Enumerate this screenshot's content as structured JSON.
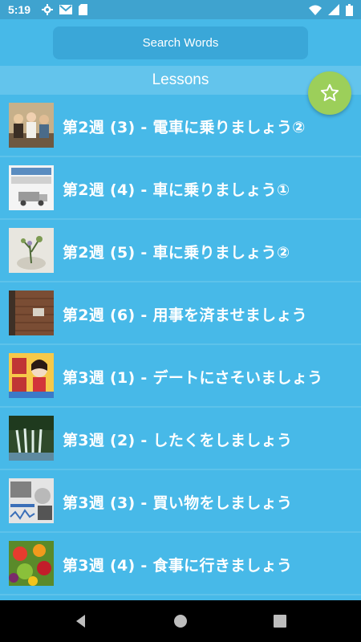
{
  "status_bar": {
    "time": "5:19",
    "left_icons": [
      "gear-icon",
      "gmail-icon",
      "sd-card-icon"
    ],
    "right_icons": [
      "wifi-icon",
      "signal-icon",
      "battery-icon"
    ]
  },
  "search": {
    "label": "Search Words"
  },
  "header": {
    "title": "Lessons"
  },
  "fab": {
    "icon": "star-outline-icon"
  },
  "lessons": [
    {
      "title": "第2週 (3) - 電車に乗りましょう②",
      "thumb": "people-group"
    },
    {
      "title": "第2週 (4) - 車に乗りましょう①",
      "thumb": "car-sign"
    },
    {
      "title": "第2週 (5) - 車に乗りましょう②",
      "thumb": "plant-vase"
    },
    {
      "title": "第2週 (6) - 用事を済ませましょう",
      "thumb": "brick-wall"
    },
    {
      "title": "第3週 (1) - デートにさそいましょう",
      "thumb": "anime-poster"
    },
    {
      "title": "第3週 (2) - したくをしましょう",
      "thumb": "waterfall"
    },
    {
      "title": "第3週 (3) - 買い物をしましょう",
      "thumb": "shop-window"
    },
    {
      "title": "第3週 (4) - 食事に行きましょう",
      "thumb": "vegetables"
    }
  ],
  "nav": {
    "buttons": [
      "back-icon",
      "home-icon",
      "recents-icon"
    ]
  },
  "colors": {
    "background": "#47b9e8",
    "status_bar": "#3fa3cf",
    "header": "#63c4ec",
    "fab": "#9ccf5a",
    "nav": "#000000"
  }
}
